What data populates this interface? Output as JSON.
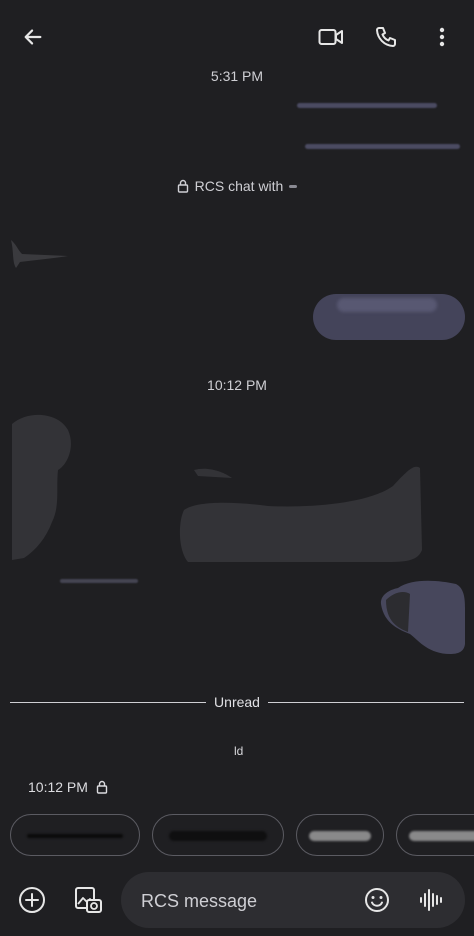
{
  "header": {
    "back_icon": "arrow-left-icon",
    "video_icon": "video-camera-icon",
    "call_icon": "phone-icon",
    "more_icon": "more-vertical-icon"
  },
  "conversation": {
    "timestamp_1": "5:31 PM",
    "rcs_notice": "RCS chat with",
    "timestamp_2": "10:12 PM",
    "unread_label": "Unread",
    "small_mark": "ld",
    "last_sent_time": "10:12 PM"
  },
  "compose": {
    "placeholder": "RCS message",
    "add_icon": "plus-circle-icon",
    "gallery_icon": "gallery-icon",
    "emoji_icon": "emoji-icon",
    "voice_icon": "voice-waveform-icon"
  },
  "colors": {
    "background": "#1f1f22",
    "outgoing_bubble": "#44445a",
    "incoming_bubble": "#333337",
    "compose_field": "#2d2d31"
  }
}
